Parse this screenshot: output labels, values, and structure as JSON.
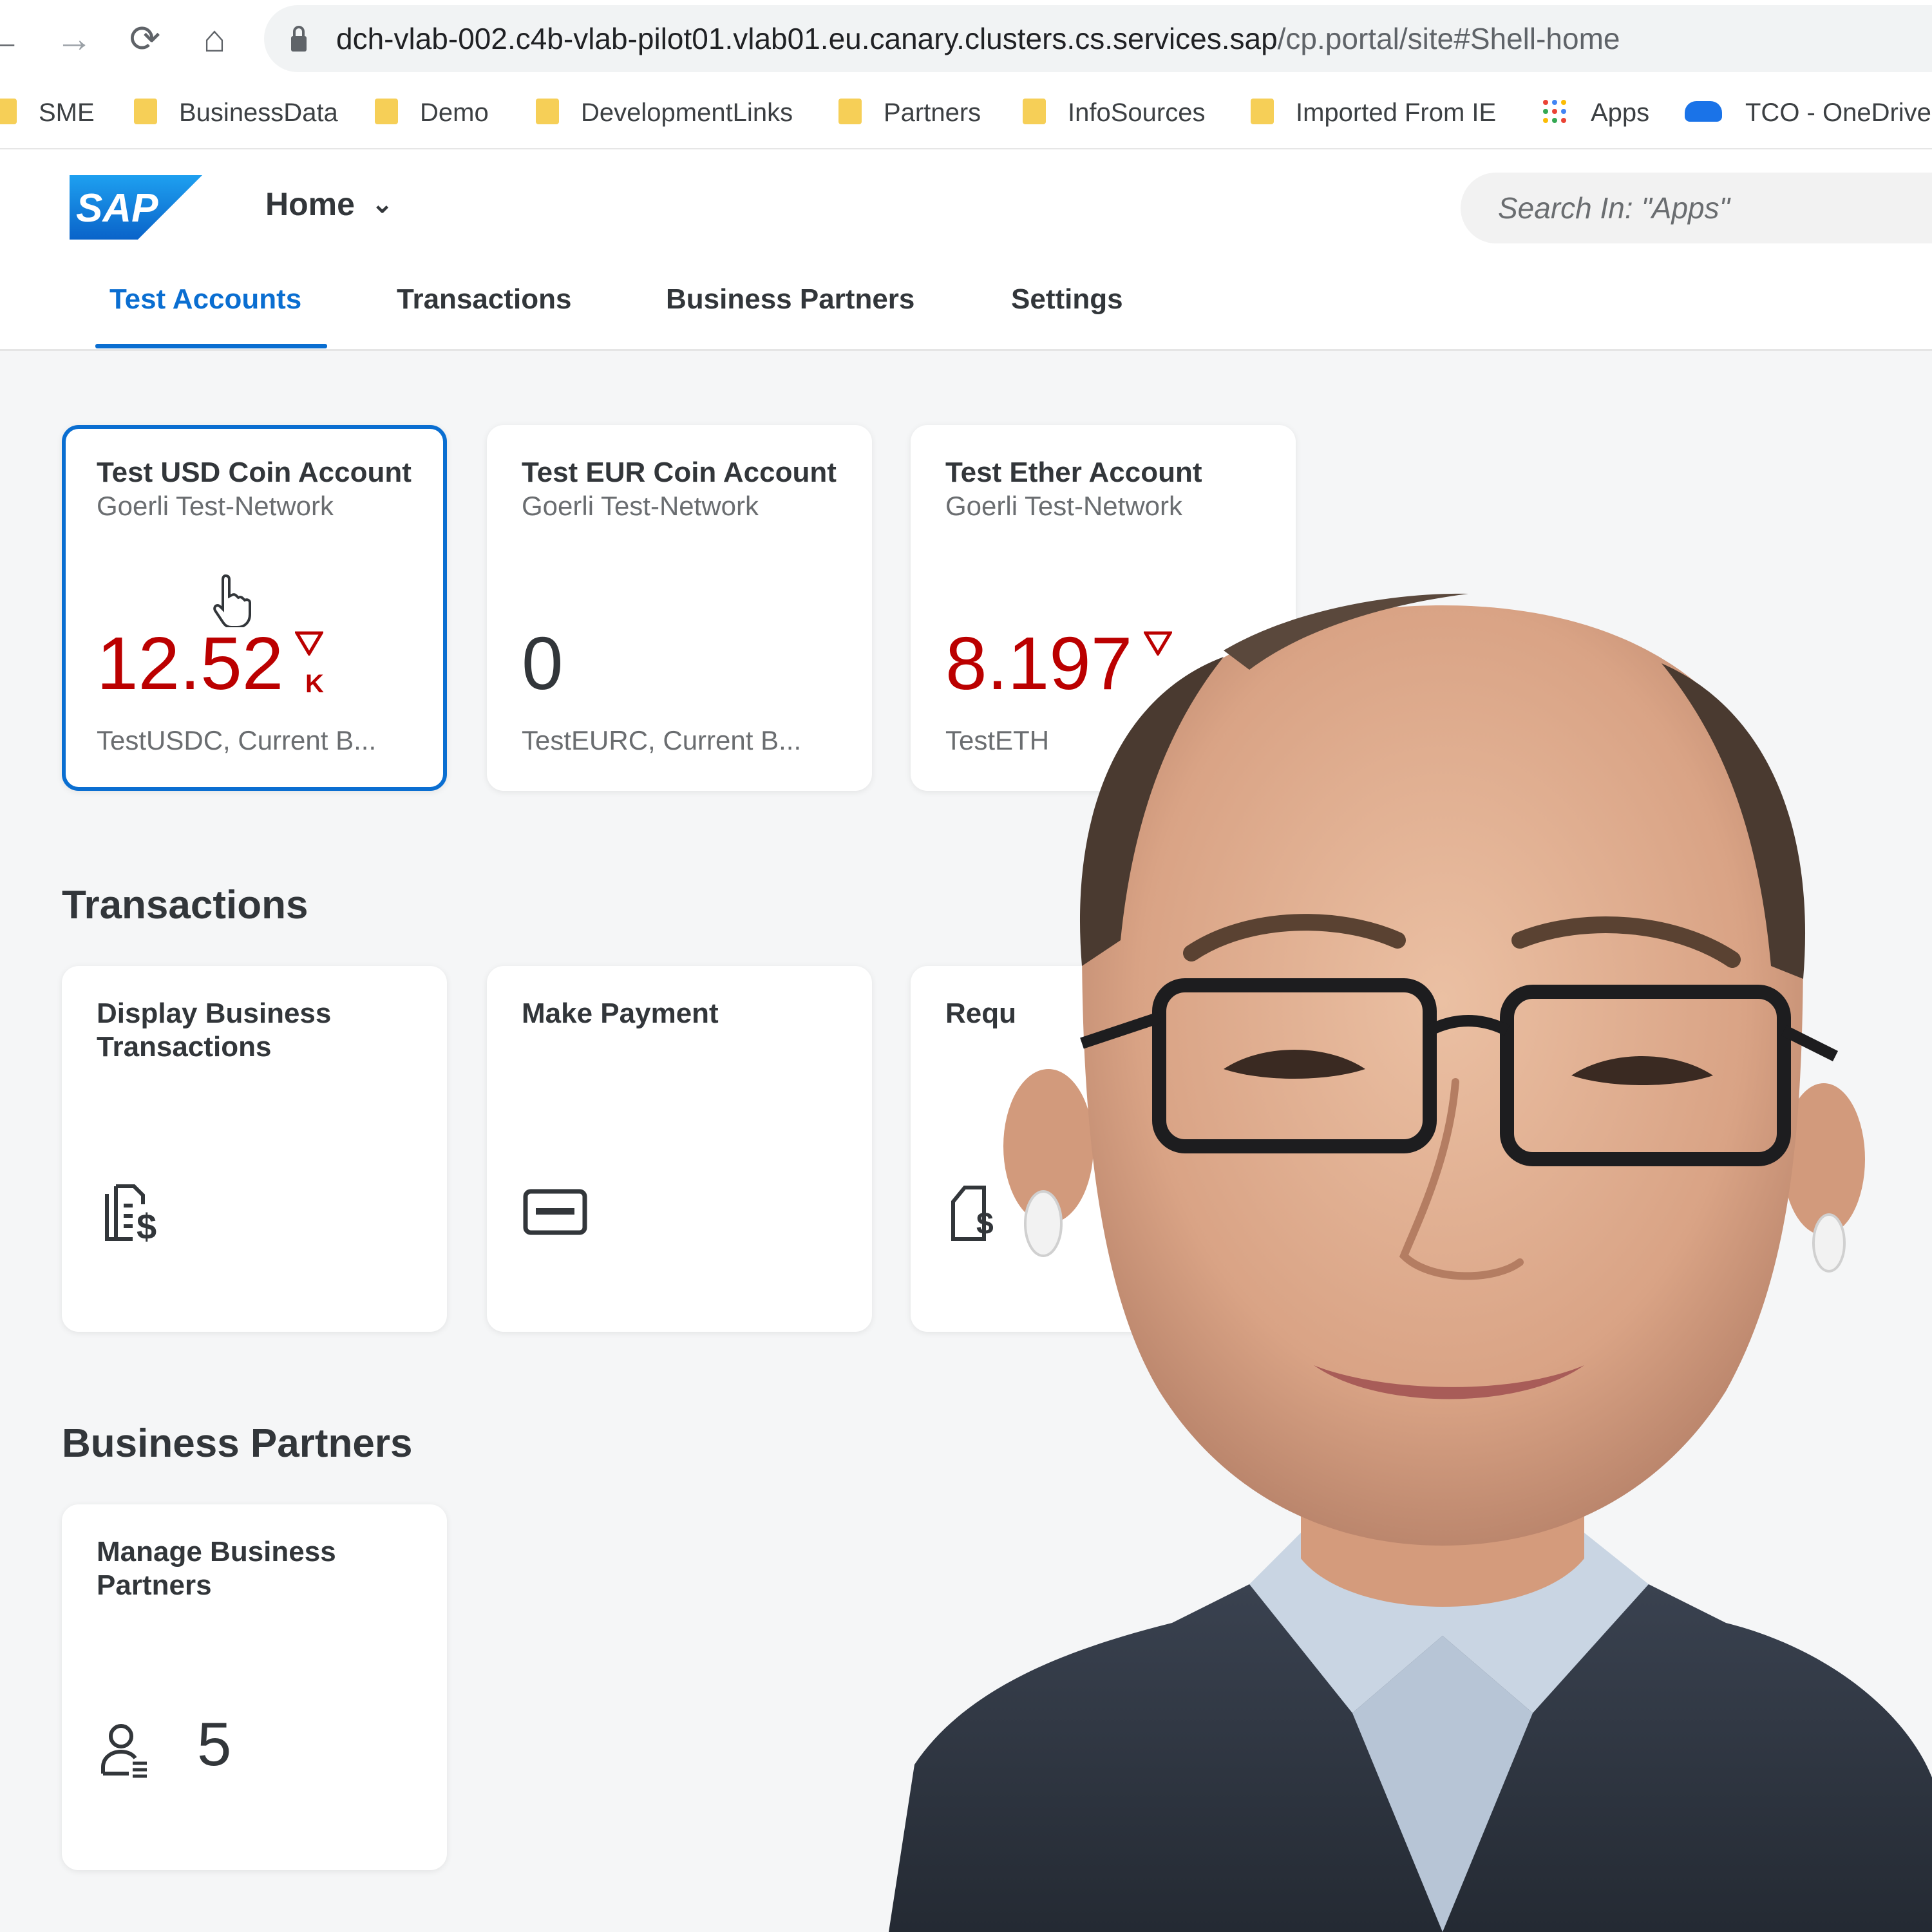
{
  "browser": {
    "url_host": "dch-vlab-002.c4b-vlab-pilot01.vlab01.eu.canary.clusters.cs.services.sap",
    "url_path": "/cp.portal/site#Shell-home",
    "bookmarks": [
      {
        "label": "SME",
        "icon": "folder"
      },
      {
        "label": "BusinessData",
        "icon": "folder"
      },
      {
        "label": "Demo",
        "icon": "folder"
      },
      {
        "label": "DevelopmentLinks",
        "icon": "folder"
      },
      {
        "label": "Partners",
        "icon": "folder"
      },
      {
        "label": "InfoSources",
        "icon": "folder"
      },
      {
        "label": "Imported From IE",
        "icon": "folder"
      },
      {
        "label": "Apps",
        "icon": "apps-grid"
      },
      {
        "label": "TCO - OneDrive",
        "icon": "onedrive-cloud"
      }
    ]
  },
  "shell": {
    "home_label": "Home",
    "search_placeholder": "Search In: \"Apps\"",
    "tabs": [
      "Test Accounts",
      "Transactions",
      "Business Partners",
      "Settings"
    ],
    "active_tab": "Test Accounts"
  },
  "test_accounts": [
    {
      "title": "Test USD Coin Account",
      "subtitle": "Goerli Test-Network",
      "value": "12.52",
      "unit": "K",
      "trend": "down",
      "footer": "TestUSDC, Current B...",
      "selected": true
    },
    {
      "title": "Test EUR Coin Account",
      "subtitle": "Goerli Test-Network",
      "value": "0",
      "footer": "TestEURC, Current B..."
    },
    {
      "title": "Test Ether Account",
      "subtitle": "Goerli Test-Network",
      "value": "8.197",
      "trend": "down",
      "footer": "TestETH"
    }
  ],
  "transactions": {
    "title": "Transactions",
    "tiles": [
      {
        "title": "Display Business Transactions",
        "icon": "document-dollar-icon"
      },
      {
        "title": "Make Payment",
        "icon": "credit-card-icon"
      },
      {
        "title": "Requ",
        "icon": "document-dollar-icon"
      }
    ]
  },
  "business_partners": {
    "title": "Business Partners",
    "tiles": [
      {
        "title": "Manage Business Partners",
        "icon": "partner-list-icon",
        "count": "5"
      }
    ]
  },
  "colors": {
    "accent": "#0a6ed1",
    "negative": "#bb0000",
    "text": "#32363a",
    "muted": "#6a6d70",
    "background": "#f5f6f7"
  }
}
